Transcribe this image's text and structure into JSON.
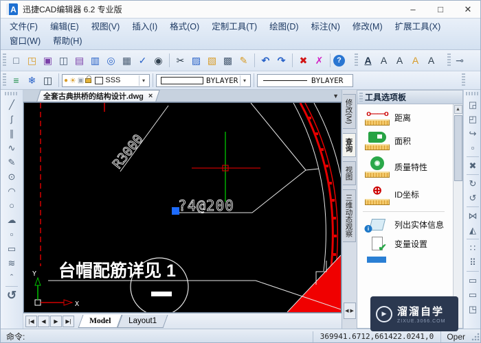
{
  "window": {
    "logo": "A",
    "title": "迅捷CAD编辑器 6.2 专业版",
    "minimize": "–",
    "maximize": "□",
    "close": "✕"
  },
  "menu": {
    "items": [
      "文件(F)",
      "编辑(E)",
      "视图(V)",
      "插入(I)",
      "格式(O)",
      "定制工具(T)",
      "绘图(D)",
      "标注(N)",
      "修改(M)",
      "扩展工具(X)",
      "窗口(W)",
      "帮助(H)"
    ]
  },
  "icons": {
    "new": "□",
    "open": "◳",
    "save": "▣",
    "export_acis": "◫",
    "batch_print": "▤",
    "print": "▥",
    "print_preview": "◎",
    "page_setup": "▦",
    "spell_check": "✓",
    "find": "◉",
    "cut": "✂",
    "copy": "▨",
    "paste": "▧",
    "paste_special": "▩",
    "format_brush": "✎",
    "undo": "↶",
    "redo": "↷",
    "erase": "✖",
    "purge": "✗",
    "help": "?",
    "text_a1": "A",
    "text_a2": "A",
    "text_a3": "A",
    "text_a4": "A",
    "text_a5": "A",
    "quick_dim": "⊸",
    "arc_c": "⊂",
    "layers": "≡",
    "layer_freeze": "❄",
    "layer_states": "◫",
    "bulb": "●",
    "sun": "☀",
    "freeze": "▣",
    "dropdown": "▾",
    "line": "╱",
    "spline": "ʃ",
    "parallel": "∥",
    "curve": "∿",
    "sketch": "✎",
    "circle": "⊙",
    "arc": "◠",
    "ellipse": "○",
    "cloud": "☁",
    "point": "▫",
    "rect": "▭",
    "spring": "≋",
    "collapse": "ˆ",
    "refresh": "↺",
    "move": "◲",
    "copy_obj": "◰",
    "edit_poly": "↪",
    "scale_sel": "▫",
    "erase_sel": "✖",
    "rotate_cw": "↻",
    "rotate_ccw": "↺",
    "mirror": "⋈",
    "trim": "◭",
    "array_rect": "∷",
    "array_polar": "⠿",
    "stretch": "▭",
    "zoom_obj": "▭",
    "explode": "◳",
    "scroll_up": "▲",
    "pager_left": "◀",
    "pager_right": "▶",
    "info_i": "i",
    "check": "✔"
  },
  "layer_bar": {
    "layer_name": "SSS",
    "color_value": "BYLAYER",
    "linetype_value": "BYLAYER"
  },
  "doc_tab": {
    "label": "全套古典拱桥的结构设计.dwg",
    "close": "×",
    "list_arrow": "▼"
  },
  "canvas": {
    "radius_label": "R3000",
    "rebar_label": "?4@200",
    "note_label": "台帽配筋详见 1",
    "axis_x": "X",
    "axis_y": "Y"
  },
  "palette": {
    "title": "工具选项板",
    "tabs": [
      "修改(M)",
      "查询",
      "视图",
      "三维动态观察"
    ],
    "items": [
      {
        "label": "距离"
      },
      {
        "label": "面积"
      },
      {
        "label": "质量特性"
      },
      {
        "label": "ID坐标"
      },
      {
        "label": "列出实体信息"
      },
      {
        "label": "变量设置"
      }
    ]
  },
  "sheet_tabs": {
    "nav": [
      "|◀",
      "◀",
      "▶",
      "▶|"
    ],
    "model": "Model",
    "layout1": "Layout1"
  },
  "status": {
    "prompt": "命令:",
    "coords": "369941.6712,661422.0241,0",
    "mode": "Oper"
  },
  "watermark": {
    "title": "溜溜自学",
    "site": "ZIXUE.3066.COM",
    "play": "▶"
  },
  "colors": {
    "accent_blue": "#2a63c8",
    "cad_red": "#ff0000",
    "cad_green": "#00d400",
    "grip_blue": "#1d6bff",
    "watermark_bg": "#2b3850"
  }
}
